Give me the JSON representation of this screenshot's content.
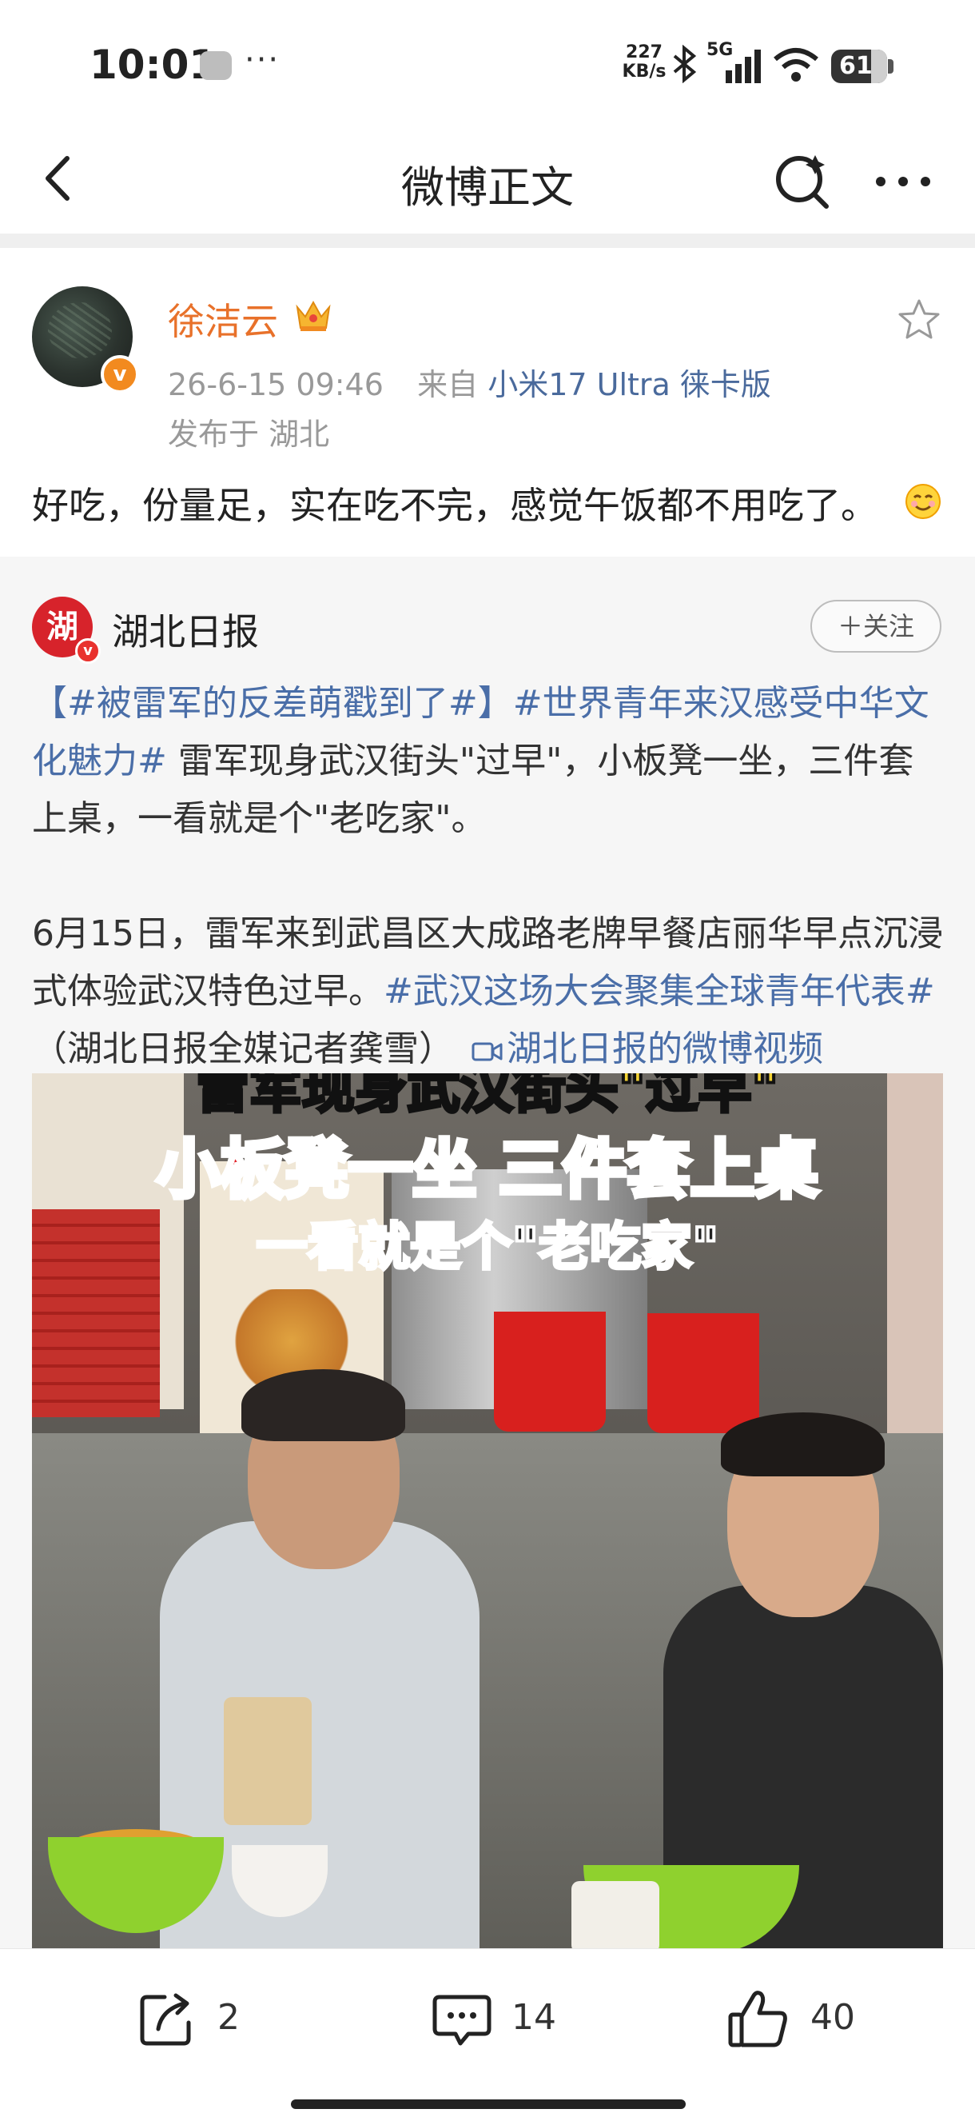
{
  "status_bar": {
    "time": "10:01",
    "dots": "···",
    "net_speed_value": "227",
    "net_speed_unit": "KB/s",
    "network": "5G",
    "battery": "61"
  },
  "nav": {
    "title": "微博正文"
  },
  "post": {
    "author": "徐洁云",
    "time": "26-6-15 09:46",
    "from_label": "来自",
    "device": "小米17 Ultra 徕卡版",
    "location": "发布于 湖北",
    "text": "好吃，份量足，实在吃不完，感觉午饭都不用吃了。"
  },
  "repost": {
    "avatar_char": "湖",
    "author": "湖北日报",
    "follow_label": "＋关注",
    "hashtag1": "【#被雷军的反差萌戳到了#】",
    "hashtag2": "#世界青年来汉感受中华文化魅力#",
    "text1": " 雷军现身武汉街头\"过早\"，小板凳一坐，三件套上桌，一看就是个\"老吃家\"。",
    "text2": "6月15日，雷军来到武昌区大成路老牌早餐店丽华早点沉浸式体验武汉特色过早。",
    "hashtag3": "#武汉这场大会聚集全球青年代表#",
    "text3": " （湖北日报全媒记者龚雪）　",
    "video_link": "湖北日报的微博视频",
    "video": {
      "caption_top": "雷军现身武汉街头\"过早\"",
      "caption_main": "小板凳一坐 三件套上桌",
      "caption_sub": "一看就是个\"老吃家\""
    }
  },
  "actions": {
    "repost_count": "2",
    "comment_count": "14",
    "like_count": "40"
  },
  "colors": {
    "author_orange": "#e8712a",
    "link_blue": "#4a6ea8",
    "card_bg": "#f6f6f6"
  }
}
